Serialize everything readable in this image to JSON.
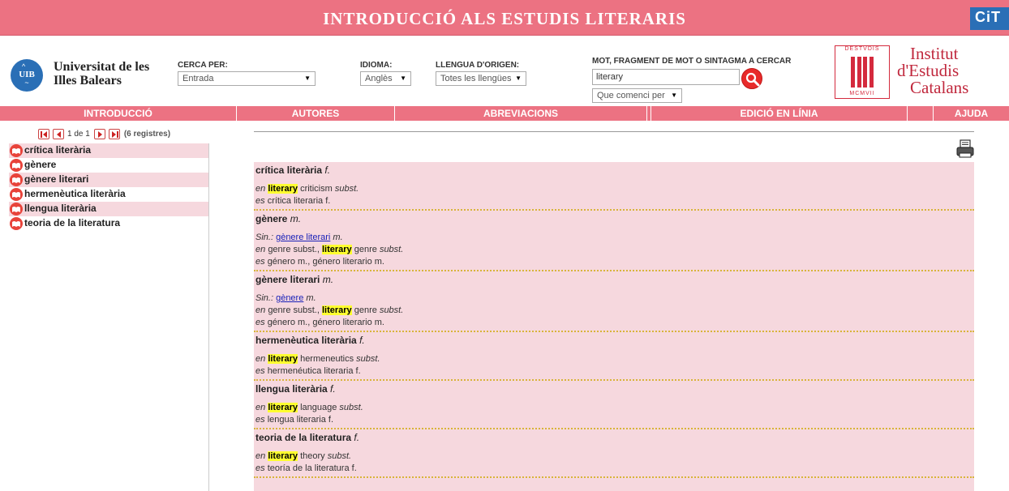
{
  "header": {
    "title": "INTRODUCCIÓ ALS ESTUDIS LITERARIS",
    "cit_logo": "CiT",
    "accent_color": "#ec7282"
  },
  "university": {
    "logo_text": "UIB",
    "name_line1": "Universitat de les",
    "name_line2": "Illes Balears"
  },
  "search_form": {
    "cerca_label": "CERCA PER:",
    "cerca_value": "Entrada",
    "idioma_label": "IDIOMA:",
    "idioma_value": "Anglès",
    "origen_label": "LLENGUA D'ORIGEN:",
    "origen_value": "Totes les llengües",
    "mot_label": "MOT, FRAGMENT DE MOT O SINTAGMA A CERCAR",
    "query": "literary",
    "mode_value": "Que comenci per"
  },
  "institute": {
    "shield_top": "DESTVDIS",
    "shield_bottom": "MCMVII",
    "name_line1": "Institut",
    "name_line2": "d'Estudis",
    "name_line3": "Catalans"
  },
  "nav": [
    {
      "label": "Introducció"
    },
    {
      "label": "Autores"
    },
    {
      "label": "Abreviacions"
    },
    {
      "label": ""
    },
    {
      "label": "Edició en línia"
    },
    {
      "label": ""
    },
    {
      "label": "Ajuda"
    }
  ],
  "pager": {
    "status": "1 de 1",
    "count": "(6 registres)"
  },
  "sidebar": {
    "items": [
      {
        "label": "crítica literària"
      },
      {
        "label": "gènere"
      },
      {
        "label": "gènere literari"
      },
      {
        "label": "hermenèutica literària"
      },
      {
        "label": "llengua literària"
      },
      {
        "label": "teoria de la literatura"
      }
    ]
  },
  "results": [
    {
      "term": "crítica literària",
      "gram": "f.",
      "syn": null,
      "en": {
        "before": "",
        "hl": "literary",
        "after": " criticism",
        "gram": "subst."
      },
      "es": "crítica literaria f."
    },
    {
      "term": "gènere",
      "gram": "m.",
      "syn": {
        "prefix": "Sin.: ",
        "link": "gènere literari",
        "gram": " m."
      },
      "en": {
        "before": "genre subst., ",
        "hl": "literary",
        "after": " genre",
        "gram": "subst."
      },
      "es": "género m., género literario m."
    },
    {
      "term": "gènere literari",
      "gram": "m.",
      "syn": {
        "prefix": "Sin.: ",
        "link": "gènere",
        "gram": " m."
      },
      "en": {
        "before": "genre subst., ",
        "hl": "literary",
        "after": " genre",
        "gram": "subst."
      },
      "es": "género m., género literario m."
    },
    {
      "term": "hermenèutica literària",
      "gram": "f.",
      "syn": null,
      "en": {
        "before": "",
        "hl": "literary",
        "after": " hermeneutics",
        "gram": "subst."
      },
      "es": "hermenéutica literaria f."
    },
    {
      "term": "llengua literària",
      "gram": "f.",
      "syn": null,
      "en": {
        "before": "",
        "hl": "literary",
        "after": " language",
        "gram": "subst."
      },
      "es": "lengua literaria f."
    },
    {
      "term": "teoria de la literatura",
      "gram": "f.",
      "syn": null,
      "en": {
        "before": "",
        "hl": "literary",
        "after": " theory",
        "gram": "subst."
      },
      "es": "teoría de la literatura f."
    }
  ]
}
